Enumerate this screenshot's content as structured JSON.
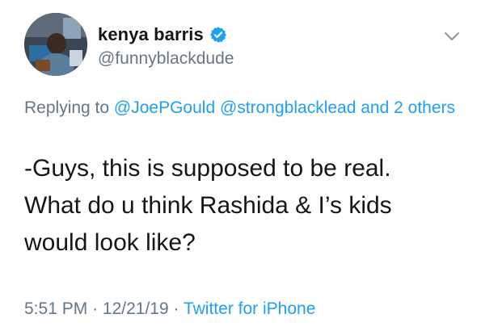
{
  "tweet": {
    "author": {
      "display_name": "kenya barris",
      "handle": "@funnyblackdude",
      "verified": true,
      "avatar_icon": "profile-photo"
    },
    "more_icon": "chevron-down-icon",
    "reply_context": {
      "prefix": "Replying to",
      "mentions": [
        "@JoePGould",
        "@strongblacklead"
      ],
      "and_others_connector": "and",
      "and_others_link": "2 others"
    },
    "text_lines": [
      "-Guys, this is supposed to be real.",
      "What do u think Rashida & I’s kids",
      "would look like?"
    ],
    "meta": {
      "time": "5:51 PM",
      "separator": "·",
      "date": "12/21/19",
      "source": "Twitter for iPhone"
    }
  },
  "colors": {
    "text": "#14171a",
    "secondary": "#657786",
    "link": "#1da1f2",
    "verified": "#1da1f2"
  }
}
